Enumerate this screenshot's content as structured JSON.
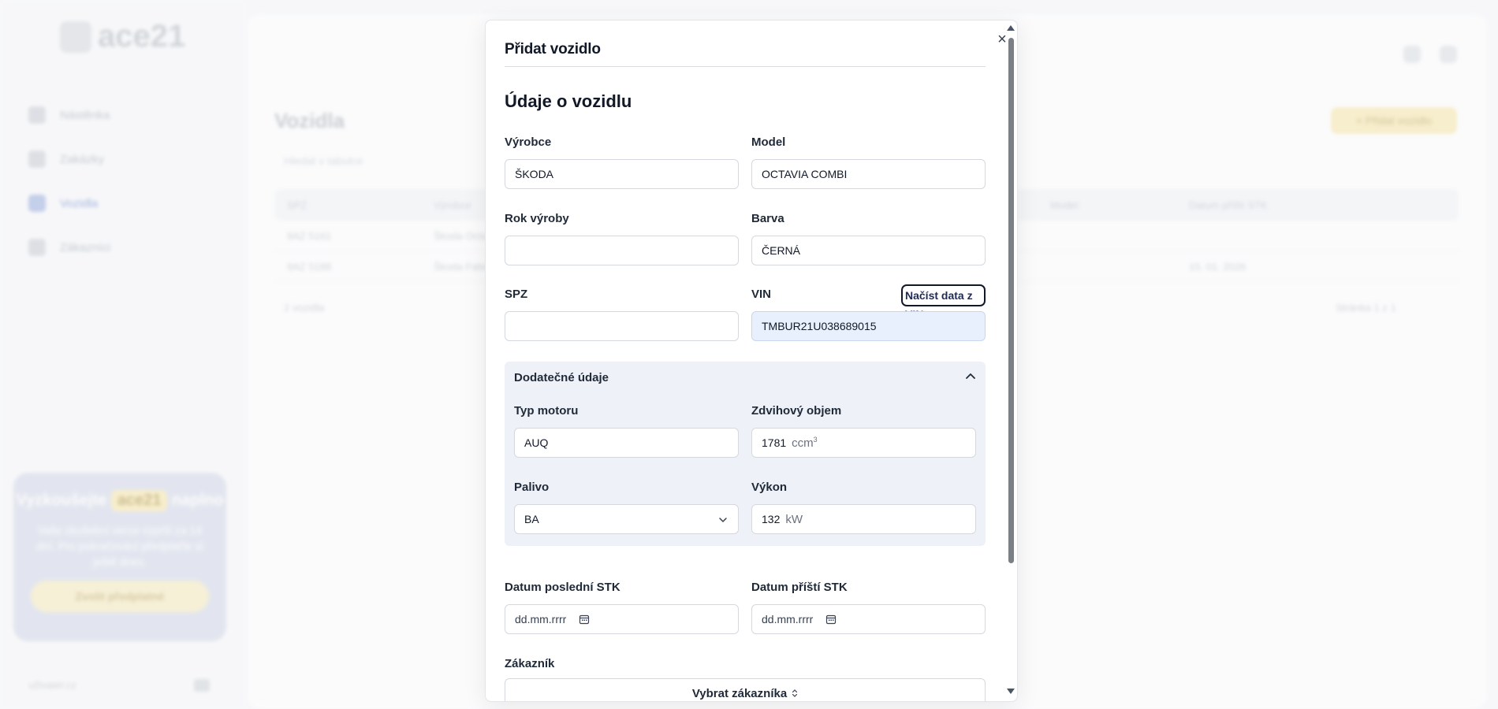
{
  "background": {
    "logo_text": "ace21",
    "nav": [
      "Nástěnka",
      "Zakázky",
      "Vozidla",
      "Zákazníci"
    ],
    "promo": {
      "title_prefix": "Vyzkoušejte",
      "badge": "ace21",
      "title_suffix": "naplno",
      "text": "Vaše zkušební verze vyprší za 14 dní. Pro pokračování předplaťte si ještě dnes.",
      "button": "Zvolit předplatné"
    },
    "footer_user": "uživatel.cz",
    "page_title": "Vozidla",
    "search_placeholder": "Hledat v tabulce",
    "add_button": "+ Přidat vozidlo",
    "table_headers": [
      "SPZ",
      "Výrobce",
      "",
      "Model",
      "Datum příští STK"
    ],
    "rows": [
      [
        "9AZ 5161",
        "Škoda Octavia",
        "",
        "",
        ""
      ],
      [
        "9AZ 5188",
        "Škoda Fabia",
        "",
        "",
        "15. 01. 2026"
      ]
    ],
    "table_footer": "2 vozidla",
    "pagination": "Stránka 1 z 1"
  },
  "modal": {
    "title": "Přidat vozidlo",
    "section_title": "Údaje o vozidlu",
    "fields": {
      "manufacturer": {
        "label": "Výrobce",
        "value": "ŠKODA"
      },
      "model": {
        "label": "Model",
        "value": "OCTAVIA COMBI"
      },
      "year": {
        "label": "Rok výroby",
        "value": ""
      },
      "color": {
        "label": "Barva",
        "value": "ČERNÁ"
      },
      "spz": {
        "label": "SPZ",
        "value": ""
      },
      "vin": {
        "label": "VIN",
        "value": "TMBUR21U038689015",
        "action": "Načíst data z VIN"
      }
    },
    "additional": {
      "title": "Dodatečné údaje",
      "engine_type": {
        "label": "Typ motoru",
        "value": "AUQ"
      },
      "displacement": {
        "label": "Zdvihový objem",
        "value": "1781",
        "unit": "ccm",
        "unit_sup": "3"
      },
      "fuel": {
        "label": "Palivo",
        "value": "BA"
      },
      "power": {
        "label": "Výkon",
        "value": "132",
        "unit": "kW"
      }
    },
    "last_stk": {
      "label": "Datum poslední STK",
      "placeholder": "dd.mm.rrrr"
    },
    "next_stk": {
      "label": "Datum příští STK",
      "placeholder": "dd.mm.rrrr"
    },
    "customer": {
      "label": "Zákazník",
      "button": "Vybrat zákazníka"
    },
    "close_glyph": "×"
  }
}
